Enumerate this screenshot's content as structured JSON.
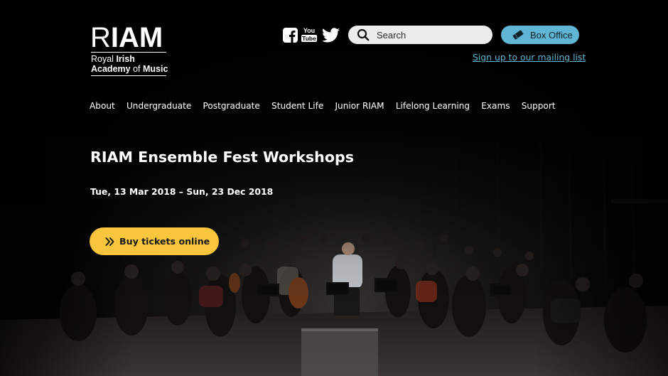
{
  "brand": {
    "logo_mark_light": "R",
    "logo_mark_bold": "IAM",
    "logo_line1_light": "Royal ",
    "logo_line1_bold": "Irish",
    "logo_line2_bold": "Academy ",
    "logo_line2_light": "of ",
    "logo_line2_bold2": "Music"
  },
  "header": {
    "social_icons": [
      "facebook-icon",
      "youtube-icon",
      "twitter-icon"
    ],
    "youtube_text_top": "You",
    "youtube_text_bottom": "Tube",
    "search_placeholder": "Search",
    "box_office_label": "Box Office",
    "mailing_link": "Sign up to our mailing list"
  },
  "nav": {
    "items": [
      {
        "label": "About"
      },
      {
        "label": "Undergraduate"
      },
      {
        "label": "Postgraduate"
      },
      {
        "label": "Student Life"
      },
      {
        "label": "Junior RIAM"
      },
      {
        "label": "Lifelong Learning"
      },
      {
        "label": "Exams"
      },
      {
        "label": "Support"
      }
    ]
  },
  "hero": {
    "title": "RIAM Ensemble Fest Workshops",
    "dates": "Tue, 13 Mar 2018 – Sun, 23 Dec 2018",
    "cta_label": "Buy tickets online",
    "cta_icon": "double-chevron-right-icon",
    "background": "orchestra-rehearsal-photo"
  },
  "colors": {
    "background": "#000000",
    "accent_blue": "#5fb5d3",
    "cta_yellow": "#f8c53d",
    "search_bg": "#ececec"
  }
}
